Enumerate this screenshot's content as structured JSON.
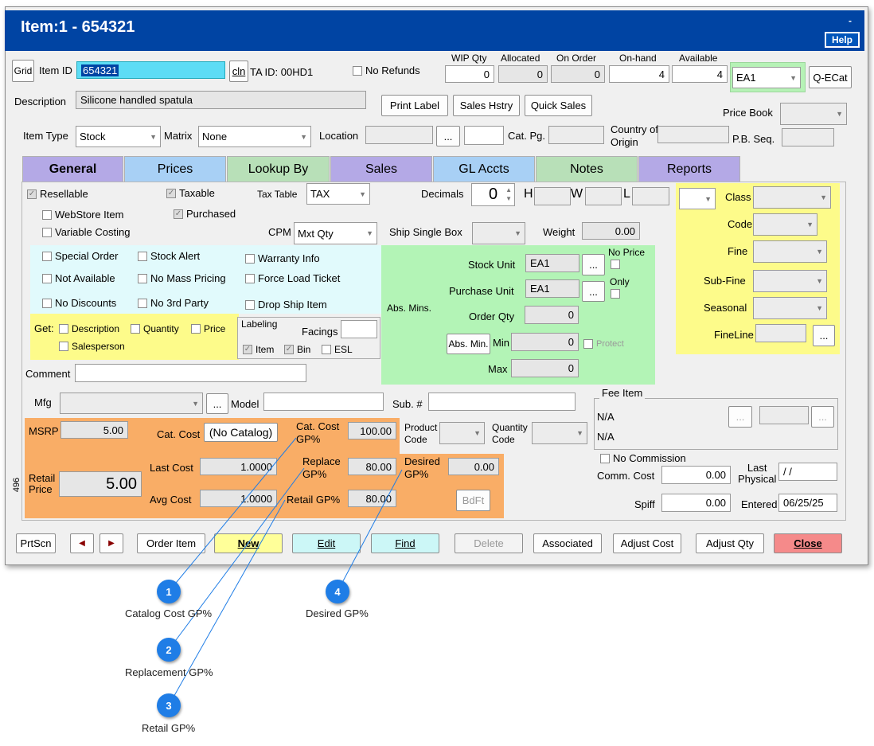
{
  "window": {
    "title": "Item:1 - 654321",
    "help": "Help",
    "minimize": "-"
  },
  "header": {
    "grid": "Grid",
    "item_id_label": "Item ID",
    "item_id": "654321",
    "cln": "cln",
    "ta_id": "TA ID:  00HD1",
    "no_refunds": "No Refunds",
    "wip_label": "WIP Qty",
    "wip": "0",
    "alloc_label": "Allocated",
    "alloc": "0",
    "onorder_label": "On Order",
    "onorder": "0",
    "onhand_label": "On-hand",
    "onhand": "4",
    "avail_label": "Available",
    "avail": "4",
    "unit": "EA1",
    "qecat": "Q-ECat",
    "desc_label": "Description",
    "desc": "Silicone handled spatula",
    "print_label": "Print Label",
    "sales_hstry": "Sales Hstry",
    "quick_sales": "Quick Sales",
    "price_book": "Price Book",
    "item_type_label": "Item Type",
    "item_type": "Stock",
    "matrix_label": "Matrix",
    "matrix": "None",
    "location_label": "Location",
    "dots": "...",
    "catpg_label": "Cat. Pg.",
    "country_label1": "Country of",
    "country_label2": "Origin",
    "pbseq_label": "P.B. Seq."
  },
  "tabs": [
    "General",
    "Prices",
    "Lookup By",
    "Sales",
    "GL Accts",
    "Notes",
    "Reports"
  ],
  "general": {
    "resellable": "Resellable",
    "taxable": "Taxable",
    "tax_table_label": "Tax Table",
    "tax_table": "TAX",
    "decimals_label": "Decimals",
    "decimals": "0",
    "h": "H",
    "w": "W",
    "l": "L",
    "webstore": "WebStore Item",
    "purchased": "Purchased",
    "variable_costing": "Variable Costing",
    "cpm_label": "CPM",
    "cpm": "Mxt Qty",
    "ship_single": "Ship Single Box",
    "weight_label": "Weight",
    "weight": "0.00",
    "special_order": "Special Order",
    "stock_alert": "Stock Alert",
    "warranty": "Warranty Info",
    "not_available": "Not Available",
    "no_mass_pricing": "No Mass Pricing",
    "force_load": "Force Load Ticket",
    "no_discounts": "No Discounts",
    "no_3rd_party": "No 3rd Party",
    "drop_ship": "Drop Ship Item",
    "get_label": "Get:",
    "get_desc": "Description",
    "get_qty": "Quantity",
    "get_price": "Price",
    "get_sales": "Salesperson",
    "labeling": "Labeling",
    "facings": "Facings",
    "lab_item": "Item",
    "lab_bin": "Bin",
    "lab_esl": "ESL",
    "stock_unit_label": "Stock Unit",
    "stock_unit": "EA1",
    "no_price": "No Price",
    "purchase_unit_label": "Purchase Unit",
    "purchase_unit": "EA1",
    "only": "Only",
    "abs_mins": "Abs. Mins.",
    "order_qty_label": "Order Qty",
    "order_qty": "0",
    "abs_min_btn": "Abs. Min.",
    "min_label": "Min",
    "min": "0",
    "protect": "Protect",
    "max_label": "Max",
    "max": "0",
    "class_label": "Class",
    "code_label": "Code",
    "fine_label": "Fine",
    "subfine_label": "Sub-Fine",
    "seasonal_label": "Seasonal",
    "fineline_label": "FineLine",
    "comment_label": "Comment",
    "mfg_label": "Mfg",
    "model_label": "Model",
    "sub_label": "Sub. #",
    "fee_item": "Fee Item",
    "na1": "N/A",
    "na2": "N/A",
    "msrp_label": "MSRP",
    "msrp": "5.00",
    "cat_cost_label": "Cat. Cost",
    "no_catalog": "(No Catalog)",
    "cat_gp_label1": "Cat. Cost",
    "cat_gp_label2": "GP%",
    "cat_gp": "100.00",
    "product_code1": "Product",
    "product_code2": "Code",
    "quantity_code1": "Quantity",
    "quantity_code2": "Code",
    "retail_label1": "Retail",
    "retail_label2": "Price",
    "retail_price": "5.00",
    "last_cost_label": "Last Cost",
    "last_cost": "1.0000",
    "replace_label1": "Replace",
    "replace_label2": "GP%",
    "replace_gp": "80.00",
    "desired_label1": "Desired",
    "desired_label2": "GP%",
    "desired_gp": "0.00",
    "avg_cost_label": "Avg Cost",
    "avg_cost": "1.0000",
    "retail_gp_label": "Retail GP%",
    "retail_gp": "80.00",
    "bdft": "BdFt",
    "side_num": "496",
    "no_commission": "No Commission",
    "comm_cost_label": "Comm. Cost",
    "comm_cost": "0.00",
    "last_physical1": "Last",
    "last_physical2": "Physical",
    "last_physical": "/  /",
    "spiff_label": "Spiff",
    "spiff": "0.00",
    "entered_label": "Entered",
    "entered": "06/25/25"
  },
  "footer": {
    "prtscn": "PrtScn",
    "order_item": "Order Item",
    "new": "New",
    "edit": "Edit",
    "find": "Find",
    "delete": "Delete",
    "associated": "Associated",
    "adjust_cost": "Adjust Cost",
    "adjust_qty": "Adjust Qty",
    "close": "Close"
  },
  "callouts": [
    {
      "num": "1",
      "label": "Catalog Cost GP%"
    },
    {
      "num": "2",
      "label": "Replacement GP%"
    },
    {
      "num": "3",
      "label": "Retail GP%"
    },
    {
      "num": "4",
      "label": "Desired GP%"
    }
  ],
  "colors": {
    "title_bar": "#0044a3",
    "tab_general": "#b4a9e6",
    "tab_prices": "#a8d0f5",
    "tab_lookup": "#b8e0b8",
    "orange_panel": "#f9ad66",
    "yellow_panel": "#fdfb8a",
    "cyan_panel": "#e1fafc",
    "green_panel": "#b3f4b6",
    "callout": "#1f7de6",
    "close_button": "#f58a8a"
  }
}
